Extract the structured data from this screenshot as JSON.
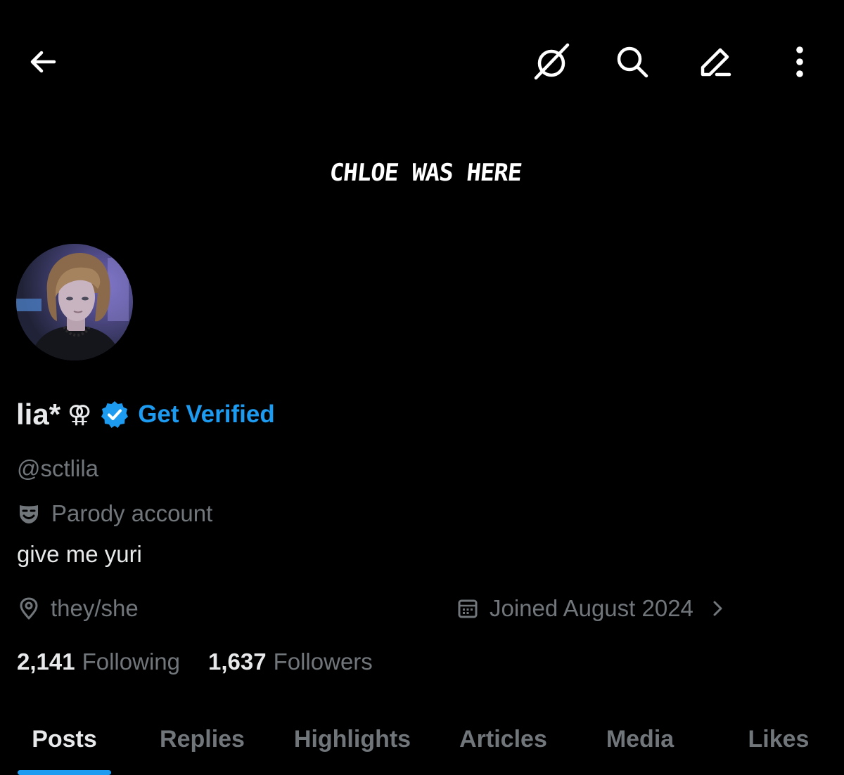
{
  "header": {
    "back_icon": "arrow-left-icon",
    "grok_icon": "slashed-circle-icon",
    "search_icon": "search-icon",
    "edit_icon": "pencil-icon",
    "more_icon": "vertical-dots-icon"
  },
  "banner": {
    "text": "CHLOE WAS HERE"
  },
  "profile": {
    "display_name": "lia*",
    "name_symbol": "⚢",
    "verified_badge_icon": "verified-badge-icon",
    "get_verified_label": "Get Verified",
    "handle": "@sctlila",
    "parody_icon": "theater-mask-icon",
    "parody_label": "Parody account",
    "bio": "give me yuri",
    "location_icon": "location-pin-icon",
    "location": "they/she",
    "joined_icon": "calendar-icon",
    "joined": "Joined August 2024",
    "joined_chevron_icon": "chevron-right-icon",
    "following_count": "2,141",
    "following_label": "Following",
    "followers_count": "1,637",
    "followers_label": "Followers"
  },
  "tabs": [
    {
      "label": "Posts",
      "active": true
    },
    {
      "label": "Replies",
      "active": false
    },
    {
      "label": "Highlights",
      "active": false
    },
    {
      "label": "Articles",
      "active": false
    },
    {
      "label": "Media",
      "active": false
    },
    {
      "label": "Likes",
      "active": false
    }
  ],
  "colors": {
    "background": "#000000",
    "primary_text": "#e7e9ea",
    "secondary_text": "#71767b",
    "accent": "#1d9bf0"
  }
}
